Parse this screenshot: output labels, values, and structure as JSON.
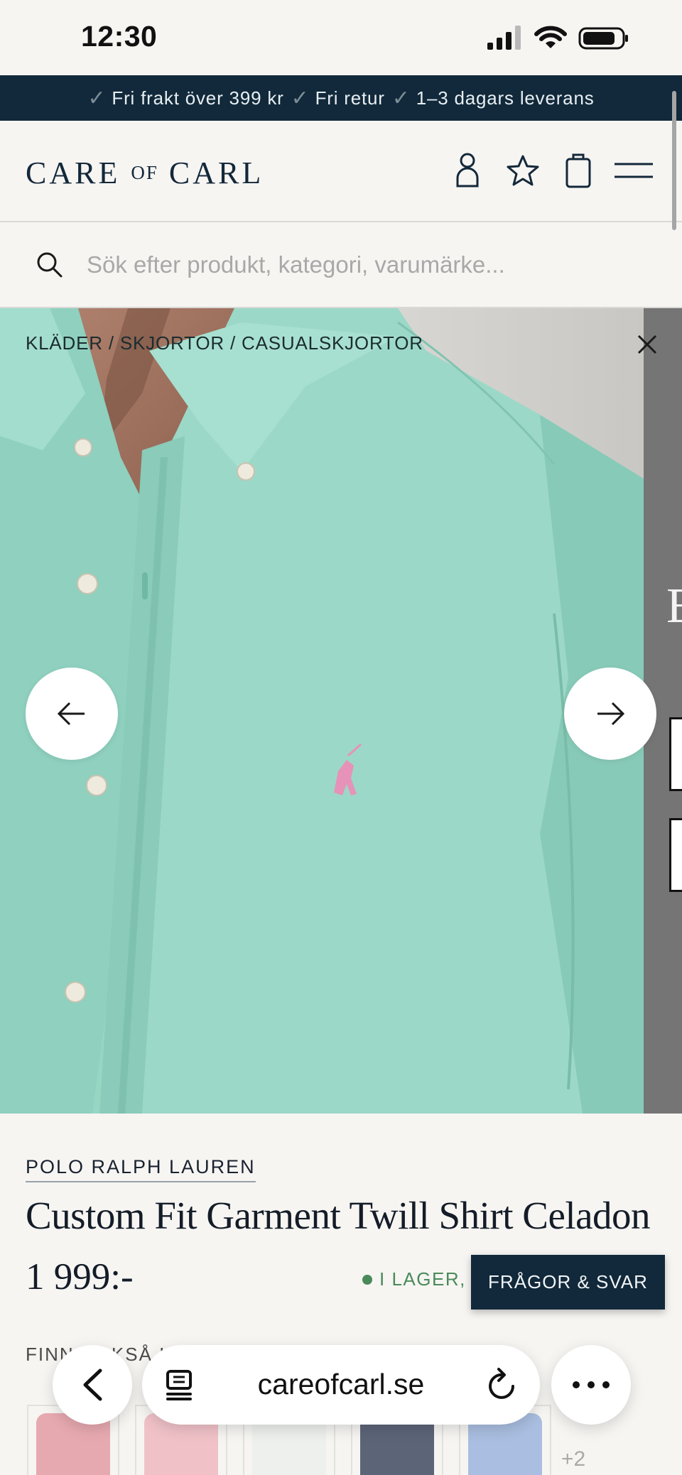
{
  "status_bar": {
    "time": "12:30"
  },
  "promo": {
    "items": [
      "Fri frakt över 399 kr",
      "Fri retur",
      "1–3 dagars leverans"
    ]
  },
  "header": {
    "logo_part1": "CARE",
    "logo_part2": "OF",
    "logo_part3": "CARL",
    "icons": [
      "account-icon",
      "favorites-icon",
      "cart-icon",
      "menu-icon"
    ]
  },
  "search": {
    "placeholder": "Sök efter produkt, kategori, varumärke..."
  },
  "gallery": {
    "breadcrumb": "KLÄDER / SKJORTOR / CASUALSKJORTOR",
    "next_image_letter": "E"
  },
  "product": {
    "brand": "POLO RALPH LAUREN",
    "title": "Custom Fit Garment Twill Shirt Celadon",
    "price": "1 999:-",
    "stock": "I LAGER,",
    "also_label": "FINN OCKSÅ I FÄRGER",
    "more_count": "+2",
    "swatch_colors": [
      "#e7a9b0",
      "#f0c2c8",
      "#eef0ee",
      "#5c6478",
      "#a9bee0"
    ]
  },
  "faq_button": {
    "label": "FRÅGOR & SVAR"
  },
  "colors": {
    "promo_bg": "#11293a",
    "accent_green": "#4a8a5a",
    "shirt": "#9ad7c6"
  },
  "browser": {
    "url": "careofcarl.se"
  }
}
